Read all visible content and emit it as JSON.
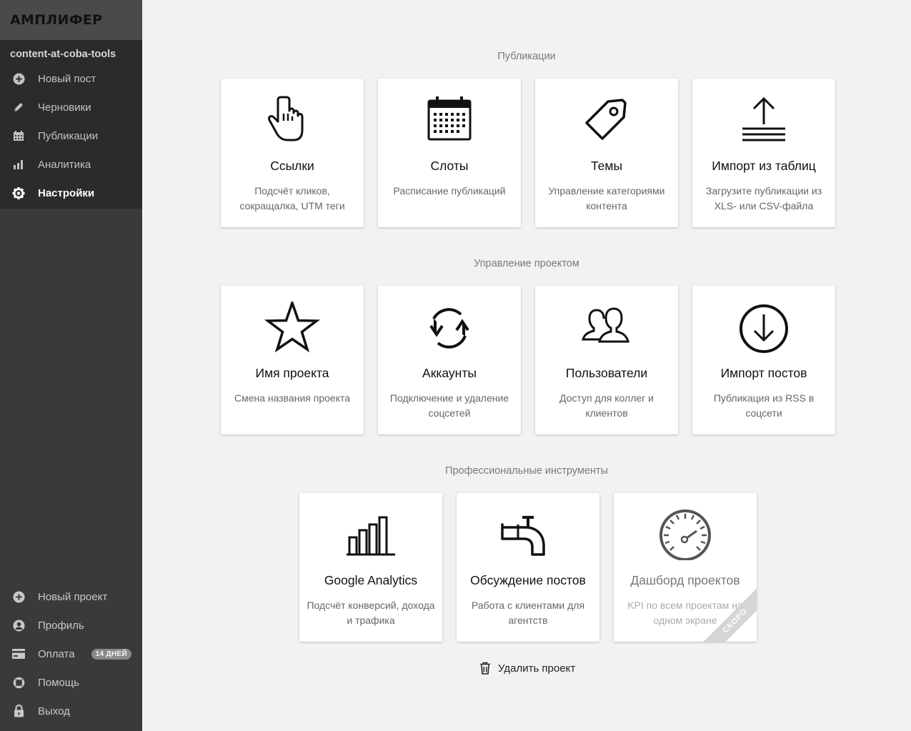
{
  "app": {
    "logo": "АМПЛИФЕР"
  },
  "sidebar": {
    "project_name": "content-at-coba-tools",
    "items": [
      {
        "label": "Новый пост",
        "icon": "plus-circle-icon"
      },
      {
        "label": "Черновики",
        "icon": "pencil-icon"
      },
      {
        "label": "Публикации",
        "icon": "calendar-icon"
      },
      {
        "label": "Аналитика",
        "icon": "bar-chart-icon"
      },
      {
        "label": "Настройки",
        "icon": "gear-icon",
        "active": true
      }
    ],
    "bottom_items": [
      {
        "label": "Новый проект",
        "icon": "plus-circle-icon"
      },
      {
        "label": "Профиль",
        "icon": "user-icon"
      },
      {
        "label": "Оплата",
        "icon": "credit-card-icon",
        "badge": "14 ДНЕЙ"
      },
      {
        "label": "Помощь",
        "icon": "lifebuoy-icon"
      },
      {
        "label": "Выход",
        "icon": "lock-icon"
      }
    ]
  },
  "sections": {
    "publications": {
      "title": "Публикации",
      "cards": [
        {
          "title": "Ссылки",
          "desc": "Подсчёт кликов, сокращалка, UTM теги",
          "icon": "pointer-hand-icon"
        },
        {
          "title": "Слоты",
          "desc": "Расписание публикаций",
          "icon": "calendar-icon"
        },
        {
          "title": "Темы",
          "desc": "Управление категориями контента",
          "icon": "tag-icon"
        },
        {
          "title": "Импорт из таблиц",
          "desc": "Загрузите публикации из XLS- или CSV-файла",
          "icon": "upload-icon"
        }
      ]
    },
    "project": {
      "title": "Управление проектом",
      "cards": [
        {
          "title": "Имя проекта",
          "desc": "Смена названия проекта",
          "icon": "star-icon"
        },
        {
          "title": "Аккаунты",
          "desc": "Подключение и удаление соцсетей",
          "icon": "refresh-icon"
        },
        {
          "title": "Пользователи",
          "desc": "Доступ для коллег и клиентов",
          "icon": "users-icon"
        },
        {
          "title": "Импорт постов",
          "desc": "Публикация из RSS в соцсети",
          "icon": "download-circle-icon"
        }
      ]
    },
    "pro": {
      "title": "Профессиональные инструменты",
      "cards": [
        {
          "title": "Google Analytics",
          "desc": "Подсчёт конверсий, дохода и трафика",
          "icon": "bar-chart-icon"
        },
        {
          "title": "Обсуждение постов",
          "desc": "Работа с клиентами для агентств",
          "icon": "pipe-valve-icon"
        },
        {
          "title": "Дашборд проектов",
          "desc": "KPI по всем проектам на одном экране",
          "icon": "speedometer-icon",
          "ribbon": "СКОРО"
        }
      ]
    }
  },
  "footer": {
    "delete_label": "Удалить проект",
    "delete_icon": "trash-icon"
  }
}
